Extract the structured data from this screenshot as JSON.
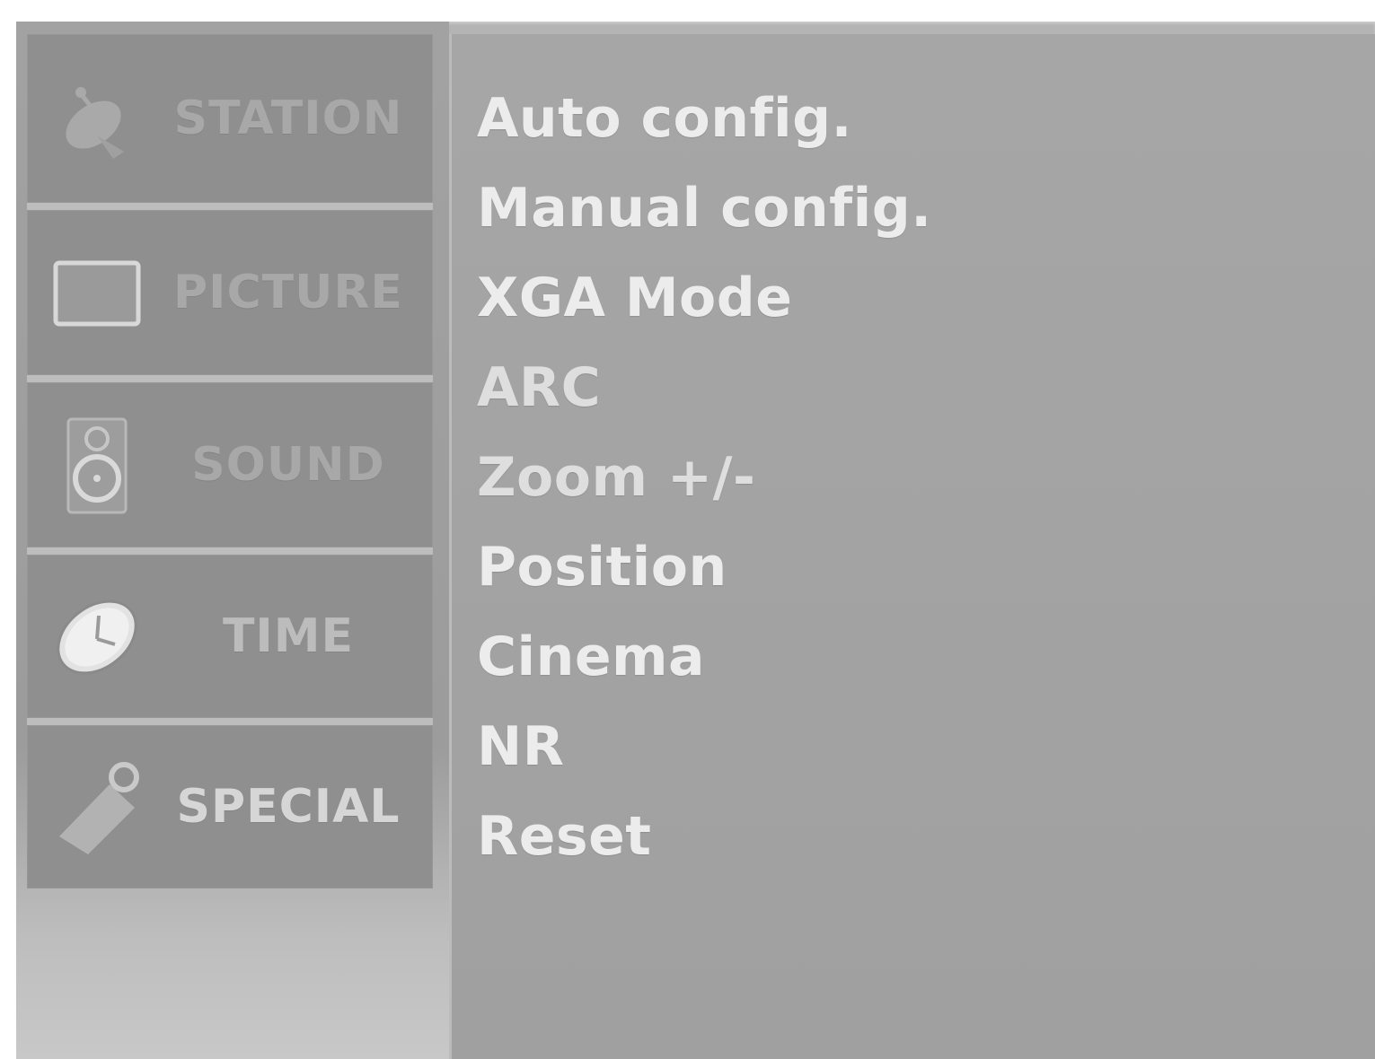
{
  "sidebar": {
    "items": [
      {
        "label": "STATION",
        "icon": "satellite-dish-icon"
      },
      {
        "label": "PICTURE",
        "icon": "tv-screen-icon"
      },
      {
        "label": "SOUND",
        "icon": "speaker-icon"
      },
      {
        "label": "TIME",
        "icon": "clock-icon"
      },
      {
        "label": "SPECIAL",
        "icon": "tag-icon"
      }
    ]
  },
  "menu": {
    "items": [
      "Auto config.",
      "Manual config.",
      "XGA Mode",
      "ARC",
      "Zoom +/-",
      "Position",
      "Cinema",
      "NR",
      "Reset"
    ]
  },
  "colors": {
    "panel": "#a4a4a4",
    "tab": "#8f8f8f",
    "text": "#ececec"
  }
}
